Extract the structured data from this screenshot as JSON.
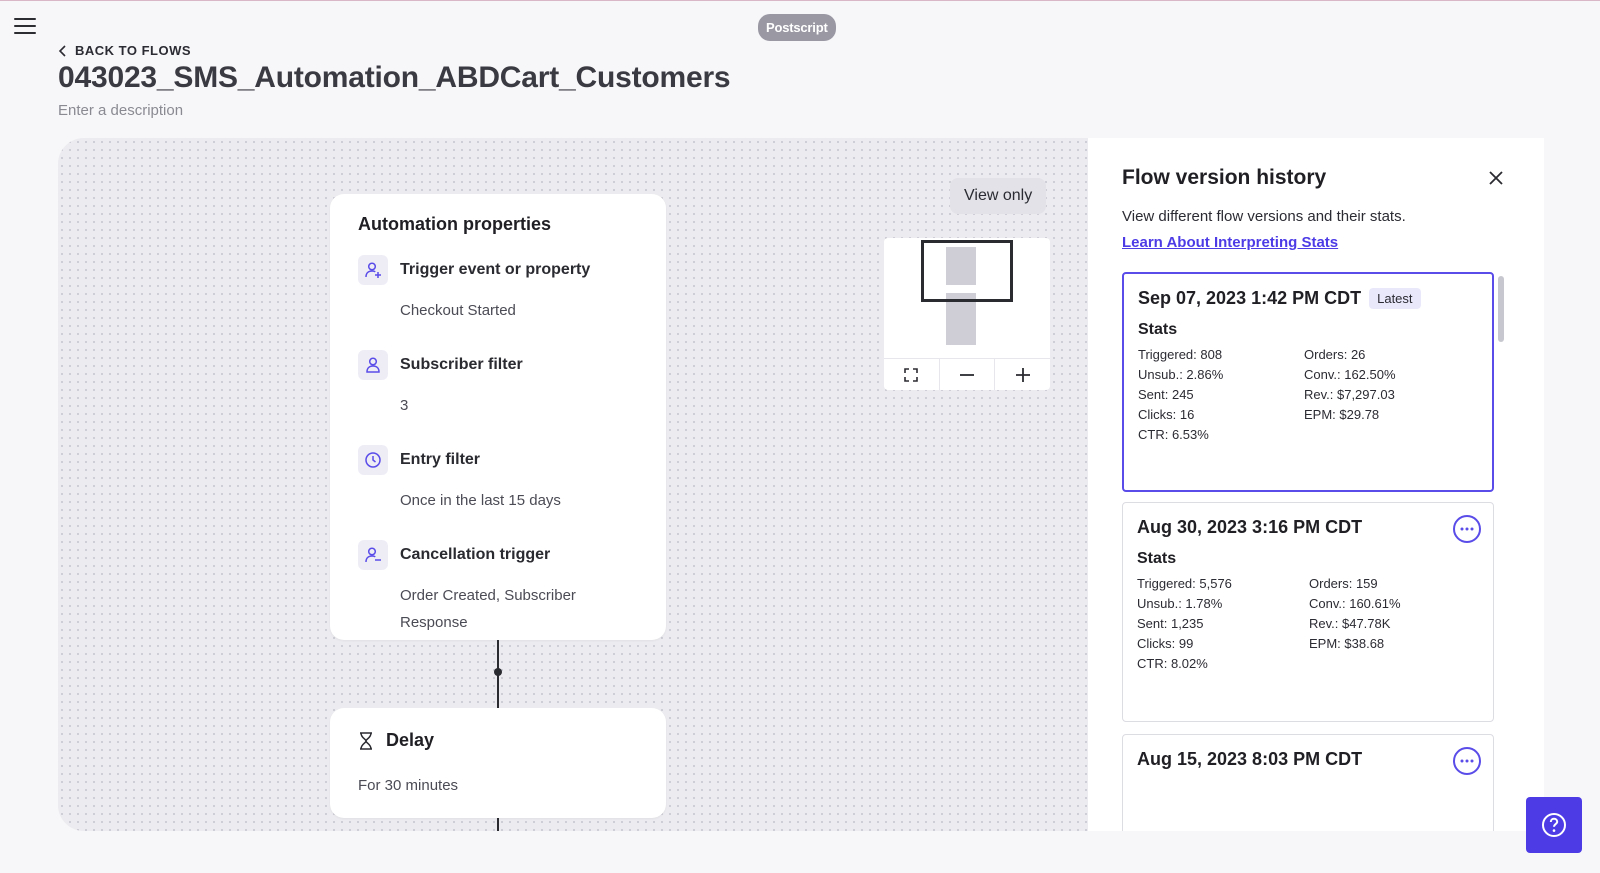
{
  "header": {
    "brand": "Postscript",
    "back_label": "BACK TO FLOWS",
    "title": "043023_SMS_Automation_ABDCart_Customers",
    "description_placeholder": "Enter a description"
  },
  "canvas": {
    "view_only_label": "View only",
    "automation_card": {
      "title": "Automation properties",
      "properties": [
        {
          "icon": "user-plus-icon",
          "title": "Trigger event or property",
          "value": "Checkout Started"
        },
        {
          "icon": "user-icon",
          "title": "Subscriber filter",
          "value": "3"
        },
        {
          "icon": "clock-icon",
          "title": "Entry filter",
          "value": "Once in the last 15 days"
        },
        {
          "icon": "user-minus-icon",
          "title": "Cancellation trigger",
          "value": "Order Created, Subscriber Response"
        }
      ]
    },
    "delay_card": {
      "title": "Delay",
      "value": "For 30 minutes",
      "icon": "hourglass-icon"
    },
    "minimap_controls": [
      "fit-view-icon",
      "zoom-out-icon",
      "zoom-in-icon"
    ]
  },
  "panel": {
    "title": "Flow version history",
    "description": "View different flow versions and their stats.",
    "link_label": "Learn About Interpreting Stats",
    "versions": [
      {
        "date": "Sep 07, 2023 1:42 PM CDT",
        "badge": "Latest",
        "stats_label": "Stats",
        "left": [
          "Triggered: 808",
          "Unsub.: 2.86%",
          "Sent: 245",
          "Clicks: 16",
          "CTR: 6.53%"
        ],
        "right": [
          "Orders: 26",
          "Conv.: 162.50%",
          "Rev.: $7,297.03",
          "EPM: $29.78"
        ]
      },
      {
        "date": "Aug 30, 2023 3:16 PM CDT",
        "badge": "",
        "stats_label": "Stats",
        "left": [
          "Triggered: 5,576",
          "Unsub.: 1.78%",
          "Sent: 1,235",
          "Clicks: 99",
          "CTR: 8.02%"
        ],
        "right": [
          "Orders: 159",
          "Conv.: 160.61%",
          "Rev.: $47.78K",
          "EPM: $38.68"
        ]
      },
      {
        "date": "Aug 15, 2023 8:03 PM CDT",
        "badge": "",
        "stats_label": "",
        "left": [],
        "right": []
      }
    ]
  },
  "colors": {
    "accent": "#4d3ce6",
    "selected_border": "#5a4ce8",
    "brand_pill": "#9a98a3"
  }
}
